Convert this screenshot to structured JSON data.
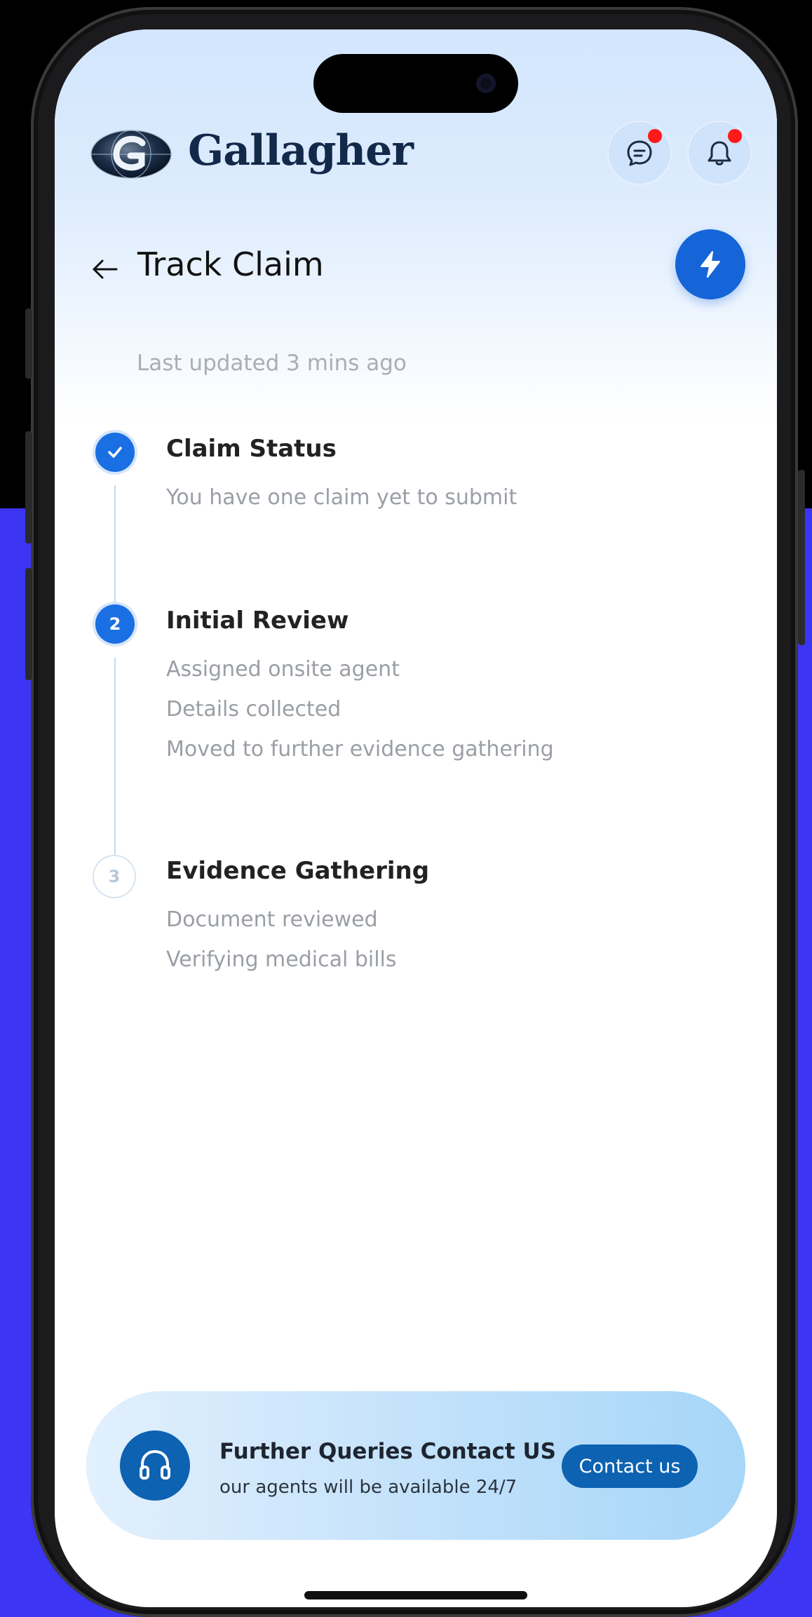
{
  "header": {
    "brand": "Gallagher",
    "messages_icon": "chat-icon",
    "notifications_icon": "bell-icon"
  },
  "page": {
    "title": "Track Claim",
    "last_updated": "Last updated 3 mins ago"
  },
  "steps": [
    {
      "marker": "",
      "state": "done",
      "title": "Claim Status",
      "details": [
        "You have one claim yet to submit"
      ]
    },
    {
      "marker": "2",
      "state": "active",
      "title": "Initial Review",
      "details": [
        "Assigned onsite agent",
        "Details collected",
        "Moved to further evidence gathering"
      ]
    },
    {
      "marker": "3",
      "state": "pending",
      "title": "Evidence Gathering",
      "details": [
        "Document reviewed",
        "Verifying medical bills"
      ]
    }
  ],
  "contact": {
    "title": "Further Queries Contact US",
    "subtitle": "our agents will be available 24/7",
    "button_label": "Contact us"
  },
  "colors": {
    "accent": "#1a6fe3",
    "brand_navy": "#12294a",
    "contact_button": "#0d62b2",
    "notification_dot": "#ff1a1a",
    "background_blue": "#3c35f3"
  }
}
